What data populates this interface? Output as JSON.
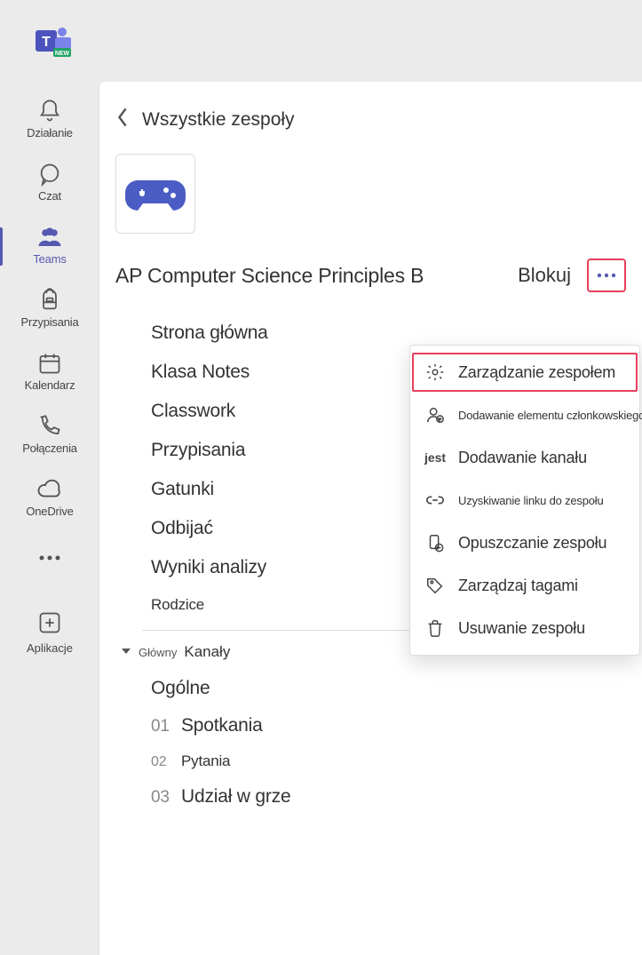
{
  "rail": {
    "items": [
      {
        "id": "activity",
        "label": "Działanie"
      },
      {
        "id": "chat",
        "label": "Czat"
      },
      {
        "id": "teams",
        "label": "Teams"
      },
      {
        "id": "assignments",
        "label": "Przypisania"
      },
      {
        "id": "calendar",
        "label": "Kalendarz"
      },
      {
        "id": "calls",
        "label": "Połączenia"
      },
      {
        "id": "onedrive",
        "label": "OneDrive"
      }
    ],
    "apps_label": "Aplikacje"
  },
  "breadcrumb": {
    "all_teams": "Wszystkie zespoły"
  },
  "team": {
    "name": "AP Computer Science Principles B",
    "lock_label": "Blokuj",
    "tabs": [
      {
        "label": "Strona główna",
        "size": "normal"
      },
      {
        "label": "Klasa Notes",
        "size": "normal"
      },
      {
        "label": "Classwork",
        "size": "normal"
      },
      {
        "label": "Przypisania",
        "size": "normal"
      },
      {
        "label": "Gatunki",
        "size": "normal"
      },
      {
        "label": "Odbijać",
        "size": "normal"
      },
      {
        "label": "Wyniki analizy",
        "size": "normal"
      },
      {
        "label": "Rodzice",
        "size": "small"
      }
    ]
  },
  "channels_section": {
    "label_small": "Główny",
    "label_big": "Kanały",
    "channels": [
      {
        "num": "",
        "label": "Ogólne",
        "size": "normal"
      },
      {
        "num": "01",
        "label": "Spotkania",
        "size": "normal"
      },
      {
        "num": "02",
        "label": "Pytania",
        "size": "small"
      },
      {
        "num": "03",
        "label": "Udział w grze",
        "size": "normal"
      }
    ]
  },
  "context_menu": {
    "items": [
      {
        "icon": "gear",
        "label": "Zarządzanie zespołem",
        "size": "med",
        "highlight": true
      },
      {
        "icon": "add-person",
        "label": "Dodawanie elementu członkowskiego",
        "size": "small"
      },
      {
        "icon": "text-jest",
        "label": "Dodawanie kanału",
        "size": "med"
      },
      {
        "icon": "link",
        "label": "Uzyskiwanie linku do zespołu",
        "size": "small"
      },
      {
        "icon": "leave",
        "label": "Opuszczanie zespołu",
        "size": "med"
      },
      {
        "icon": "tag",
        "label": "Zarządzaj tagami",
        "size": "med"
      },
      {
        "icon": "trash",
        "label": "Usuwanie zespołu",
        "size": "med"
      }
    ]
  }
}
